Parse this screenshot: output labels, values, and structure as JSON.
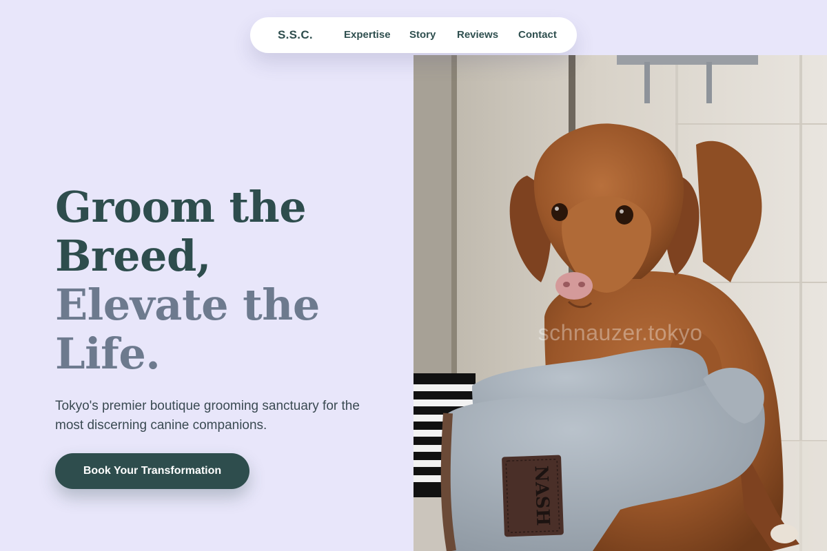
{
  "nav": {
    "brand": "S.S.C.",
    "links": [
      {
        "label": "Expertise"
      },
      {
        "label": "Story"
      },
      {
        "label": "Reviews"
      },
      {
        "label": "Contact"
      }
    ]
  },
  "hero": {
    "headline": {
      "line1": "Groom the",
      "line2": "Breed,",
      "line3": "Elevate the",
      "line4": "Life."
    },
    "subtitle": "Tokyo's premier boutique grooming sanctuary for the most discerning canine companions.",
    "cta_label": "Book Your Transformation"
  },
  "image": {
    "watermark": "schnauzer.tokyo",
    "glove_brand": "NASH",
    "subject": "wet brown retriever dog held by grey towel grooming gloves in a shower"
  },
  "colors": {
    "page_background": "#e8e6fa",
    "primary_dark_green": "#2e4d4d",
    "headline_muted": "#6d7a8e",
    "nav_background": "#ffffff"
  }
}
